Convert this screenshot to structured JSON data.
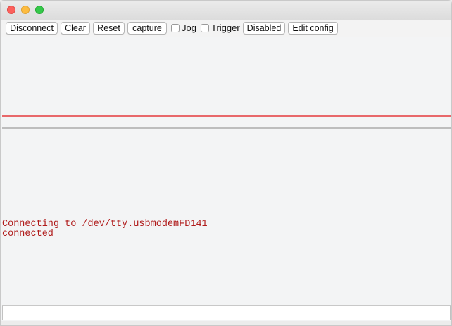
{
  "window": {
    "controls": [
      "close",
      "minimize",
      "zoom"
    ],
    "colors": {
      "close": "#fc605c",
      "minimize": "#fdbc40",
      "zoom": "#34c84a"
    }
  },
  "toolbar": {
    "disconnect_label": "Disconnect",
    "clear_label": "Clear",
    "reset_label": "Reset",
    "capture_label": "capture",
    "jog_label": "Jog",
    "jog_checked": false,
    "trigger_label": "Trigger",
    "trigger_checked": false,
    "disabled_label": "Disabled",
    "edit_config_label": "Edit config"
  },
  "plot": {
    "trace_color": "#e8686a"
  },
  "console": {
    "text_color": "#b01b1b",
    "lines": [
      "Connecting to /dev/tty.usbmodemFD141",
      "connected"
    ]
  },
  "command_input": {
    "value": "",
    "placeholder": ""
  }
}
